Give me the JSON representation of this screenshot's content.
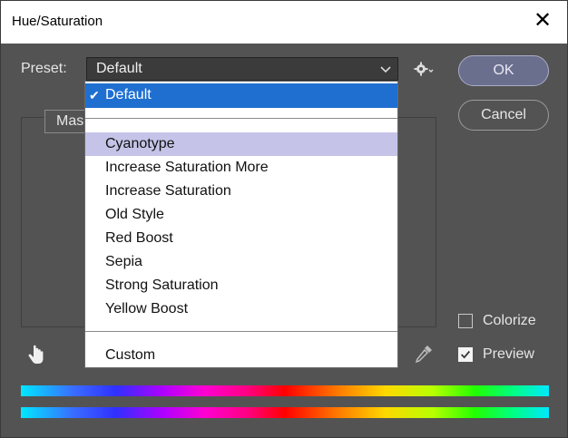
{
  "window": {
    "title": "Hue/Saturation"
  },
  "preset": {
    "label": "Preset:",
    "value": "Default",
    "items": [
      "Default",
      "Cyanotype",
      "Increase Saturation More",
      "Increase Saturation",
      "Old Style",
      "Red Boost",
      "Sepia",
      "Strong Saturation",
      "Yellow Boost",
      "Custom"
    ]
  },
  "buttons": {
    "ok": "OK",
    "cancel": "Cancel"
  },
  "panel": {
    "tab_partial": "Mas"
  },
  "options": {
    "colorize": "Colorize",
    "preview": "Preview",
    "colorize_checked": false,
    "preview_checked": true
  },
  "colors": {
    "selected": "#1f6fd0",
    "hover": "#c5c4e8",
    "ok_button": "#6b6f8e"
  },
  "icons": [
    "close-icon",
    "chevron-down-icon",
    "gear-icon",
    "hand-adjust-icon",
    "eyedropper-icon",
    "checkmark-icon"
  ]
}
